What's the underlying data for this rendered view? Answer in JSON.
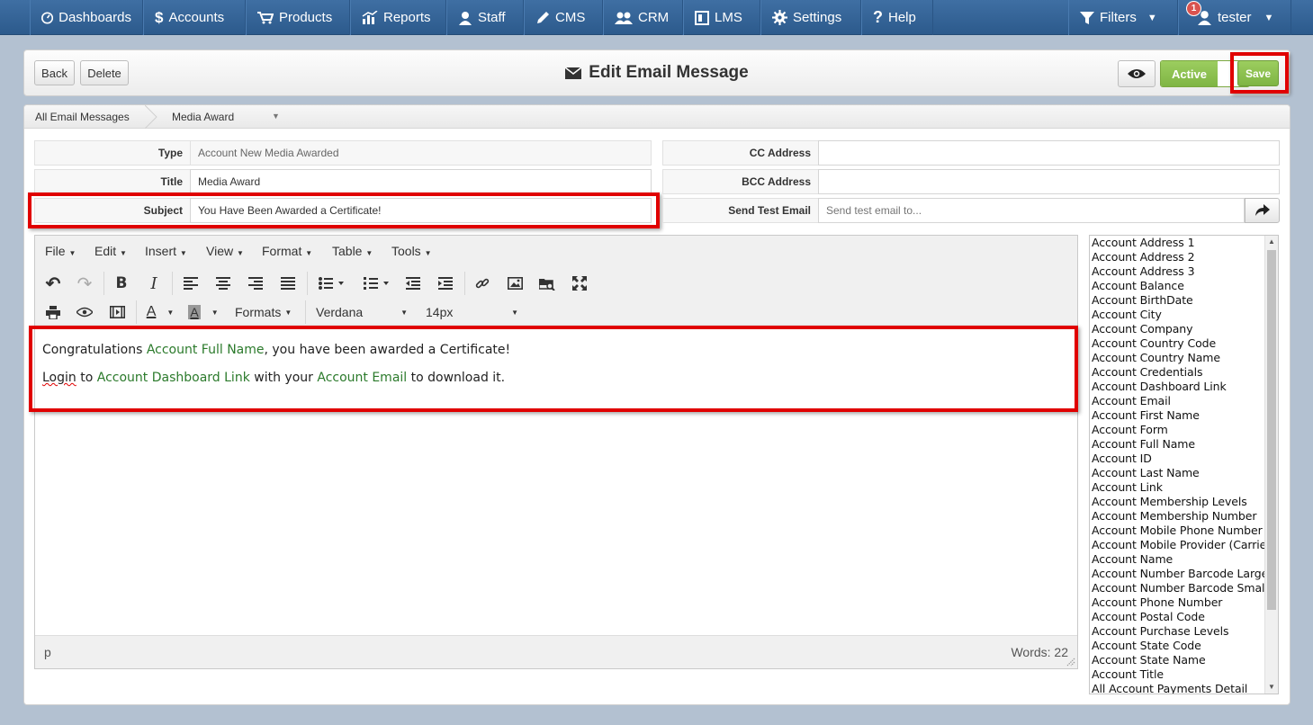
{
  "nav": {
    "items": [
      {
        "label": "Dashboards",
        "icon": "dashboard-icon"
      },
      {
        "label": "Accounts",
        "icon": "dollar-icon"
      },
      {
        "label": "Products",
        "icon": "cart-icon"
      },
      {
        "label": "Reports",
        "icon": "chart-icon"
      },
      {
        "label": "Staff",
        "icon": "user-icon"
      },
      {
        "label": "CMS",
        "icon": "pencil-icon"
      },
      {
        "label": "CRM",
        "icon": "users-icon"
      },
      {
        "label": "LMS",
        "icon": "book-icon"
      },
      {
        "label": "Settings",
        "icon": "gear-icon"
      },
      {
        "label": "Help",
        "icon": "question-icon"
      }
    ],
    "filters_label": "Filters",
    "user_label": "tester",
    "notification_count": "1"
  },
  "header": {
    "back_label": "Back",
    "delete_label": "Delete",
    "title": "Edit Email Message",
    "active_label": "Active",
    "save_label": "Save"
  },
  "breadcrumb": {
    "root": "All Email Messages",
    "current": "Media Award"
  },
  "form": {
    "type_label": "Type",
    "type_value": "Account New Media Awarded",
    "title_label": "Title",
    "title_value": "Media Award",
    "subject_label": "Subject",
    "subject_value": "You Have Been Awarded a Certificate!",
    "cc_label": "CC Address",
    "cc_value": "",
    "bcc_label": "BCC Address",
    "bcc_value": "",
    "test_label": "Send Test Email",
    "test_placeholder": "Send test email to..."
  },
  "editor": {
    "menus": [
      "File",
      "Edit",
      "Insert",
      "View",
      "Format",
      "Table",
      "Tools"
    ],
    "formats_label": "Formats",
    "font_family": "Verdana",
    "font_size": "14px",
    "line1": {
      "a": "Congratulations ",
      "v1": "Account Full Name",
      "b": ", you have been awarded a Certificate!"
    },
    "line2": {
      "a": "Login",
      "b": " to ",
      "v1": "Account Dashboard Link",
      "c": " with your ",
      "v2": "Account Email",
      "d": " to download it."
    },
    "status_path": "p",
    "word_count": "Words: 22"
  },
  "variables": [
    "Account Address 1",
    "Account Address 2",
    "Account Address 3",
    "Account Balance",
    "Account BirthDate",
    "Account City",
    "Account Company",
    "Account Country Code",
    "Account Country Name",
    "Account Credentials",
    "Account Dashboard Link",
    "Account Email",
    "Account First Name",
    "Account Form",
    "Account Full Name",
    "Account ID",
    "Account Last Name",
    "Account Link",
    "Account Membership Levels",
    "Account Membership Number",
    "Account Mobile Phone Number",
    "Account Mobile Provider (Carrier)",
    "Account Name",
    "Account Number Barcode Large",
    "Account Number Barcode Small",
    "Account Phone Number",
    "Account Postal Code",
    "Account Purchase Levels",
    "Account State Code",
    "Account State Name",
    "Account Title",
    "All Account Payments Detail"
  ],
  "colors": {
    "nav": "#2f5f93",
    "active": "#8cc152",
    "highlight": "#e00000",
    "variable": "#2b7a2b"
  }
}
